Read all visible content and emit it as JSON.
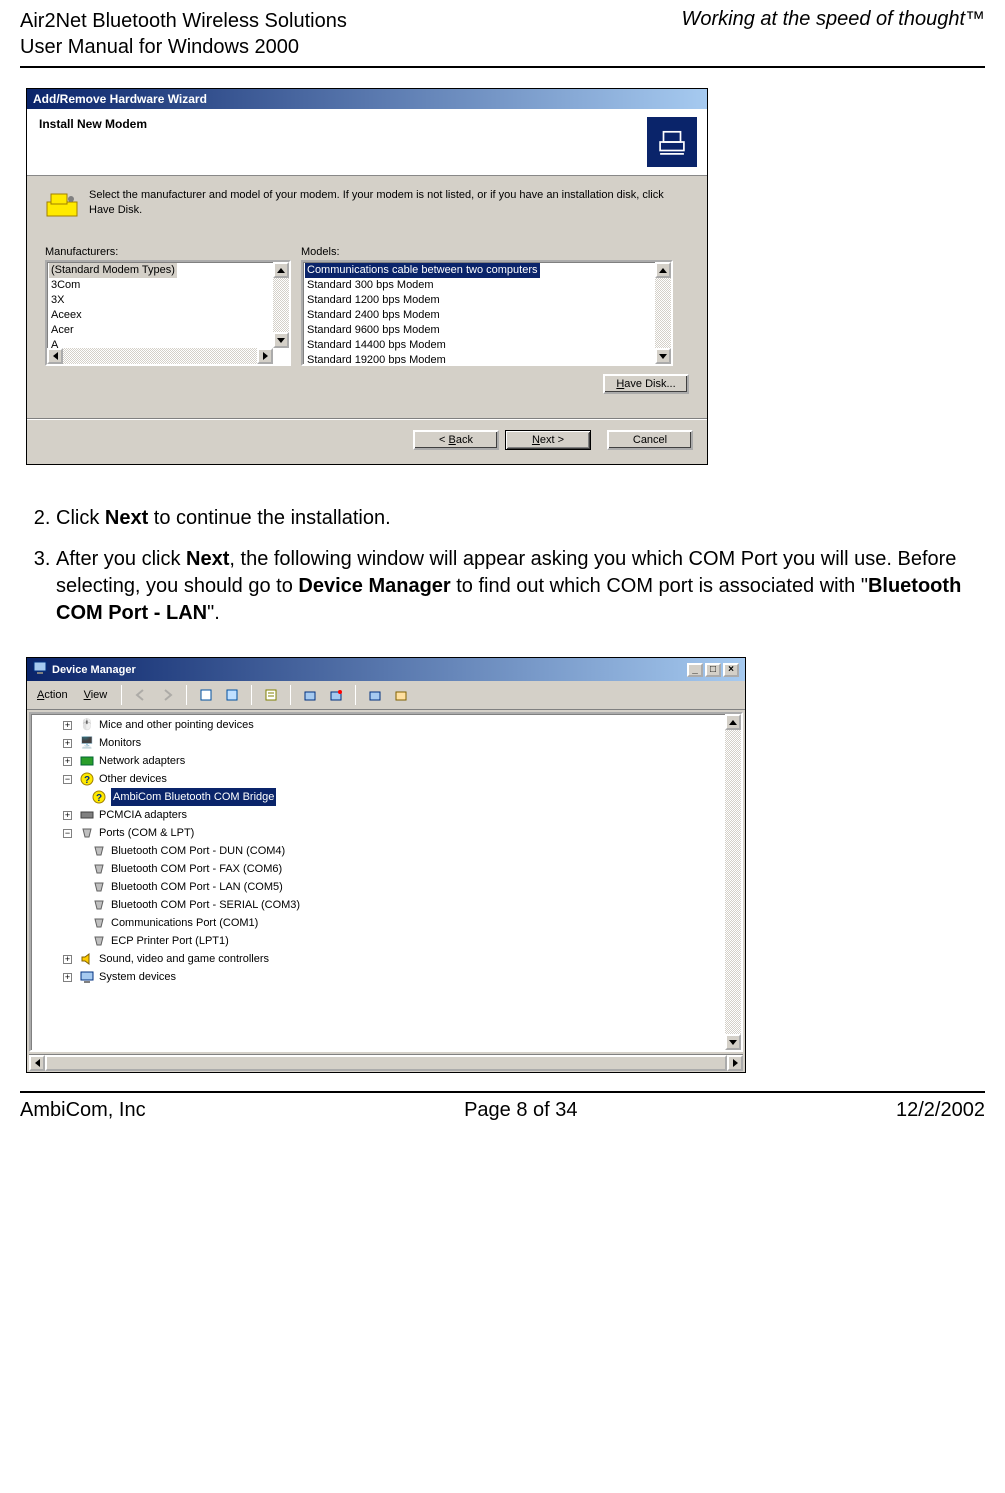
{
  "page_header": {
    "left_line1": "Air2Net Bluetooth Wireless Solutions",
    "left_line2": "User Manual for Windows 2000",
    "right": "Working at the speed of thought™"
  },
  "page_footer": {
    "left": "AmbiCom, Inc",
    "center": "Page 8 of 34",
    "right": "12/2/2002"
  },
  "steps": {
    "s2_a": "Click ",
    "s2_b": "Next",
    "s2_c": " to continue the installation.",
    "s3_a": "After you click ",
    "s3_b": "Next",
    "s3_c": ", the following window will appear asking you which COM Port you will use. Before selecting, you should go to ",
    "s3_d": "Device Manager",
    "s3_e": " to find out which COM port is associated with \"",
    "s3_f": "Bluetooth COM Port - LAN",
    "s3_g": "\"."
  },
  "wizard": {
    "title": "Add/Remove Hardware Wizard",
    "subtitle": "Install New Modem",
    "instr": "Select the manufacturer and model of your modem. If your modem is not listed, or if you have an installation disk, click Have Disk.",
    "label_manufacturers": "Manufacturers:",
    "label_models": "Models:",
    "manufacturers": [
      "(Standard Modem Types)",
      "3Com",
      "3X",
      "Aceex",
      "Acer"
    ],
    "manufacturer_cut": "A",
    "models": [
      "Communications cable between two computers",
      "Standard    300 bps Modem",
      "Standard  1200 bps Modem",
      "Standard  2400 bps Modem",
      "Standard  9600 bps Modem",
      "Standard 14400 bps Modem",
      "Standard 19200 bps Modem"
    ],
    "have_disk": "Have Disk...",
    "back": "< Back",
    "next": "Next >",
    "cancel": "Cancel"
  },
  "device_manager": {
    "title": "Device Manager",
    "menu_action": "Action",
    "menu_view": "View",
    "tree": {
      "mice": "Mice and other pointing devices",
      "monitors": "Monitors",
      "network": "Network adapters",
      "other": "Other devices",
      "other_child": "AmbiCom Bluetooth COM Bridge",
      "pcmcia": "PCMCIA adapters",
      "ports": "Ports (COM & LPT)",
      "port_items": [
        "Bluetooth COM Port - DUN (COM4)",
        "Bluetooth COM Port - FAX (COM6)",
        "Bluetooth COM Port - LAN (COM5)",
        "Bluetooth COM Port - SERIAL (COM3)",
        "Communications Port (COM1)",
        "ECP Printer Port (LPT1)"
      ],
      "sound": "Sound, video and game controllers",
      "system": "System devices"
    }
  }
}
